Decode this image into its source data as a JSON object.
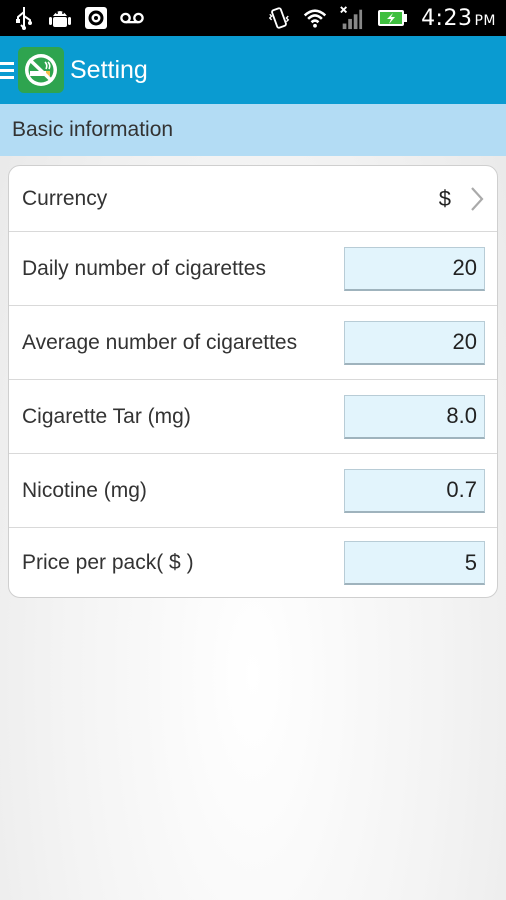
{
  "status_bar": {
    "time": "4:23",
    "ampm": "PM",
    "icons": [
      "usb-icon",
      "android-debug-icon",
      "settings-icon",
      "voicemail-icon",
      "vibrate-icon",
      "wifi-icon",
      "signal-icon",
      "battery-charging-icon"
    ]
  },
  "action_bar": {
    "title": "Setting",
    "logo_icon": "no-smoking-icon",
    "accent_color": "#0a9bd1"
  },
  "section": {
    "title": "Basic information"
  },
  "settings": {
    "currency": {
      "label": "Currency",
      "value": "$"
    },
    "daily": {
      "label": "Daily number of cigarettes",
      "value": "20"
    },
    "average": {
      "label": "Average number of cigarettes",
      "value": "20"
    },
    "tar": {
      "label": "Cigarette Tar (mg)",
      "value": "8.0"
    },
    "nicotine": {
      "label": "Nicotine (mg)",
      "value": "0.7"
    },
    "price": {
      "label": "Price per pack( $ )",
      "value": "5"
    }
  }
}
